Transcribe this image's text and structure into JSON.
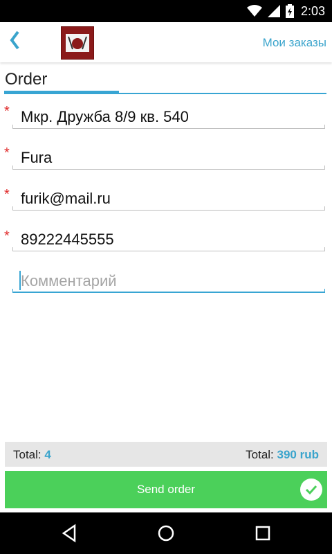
{
  "status_bar": {
    "time": "2:03"
  },
  "header": {
    "back_icon": "chevron-left-icon",
    "orders_link": "Мои заказы"
  },
  "section": {
    "title": "Order"
  },
  "form": {
    "address": "Мкр. Дружба 8/9 кв. 540",
    "name": "Fura",
    "email": "furik@mail.ru",
    "phone": "89222445555",
    "comment_placeholder": "Комментарий",
    "required_mark": "*"
  },
  "totals": {
    "count_label": "Total:",
    "count_value": "4",
    "sum_label": "Total:",
    "sum_value": "390 rub"
  },
  "send_button": {
    "label": "Send order"
  },
  "colors": {
    "accent": "#3aa4cc",
    "send_green": "#4bd05a",
    "required_red": "#e02a2a"
  }
}
